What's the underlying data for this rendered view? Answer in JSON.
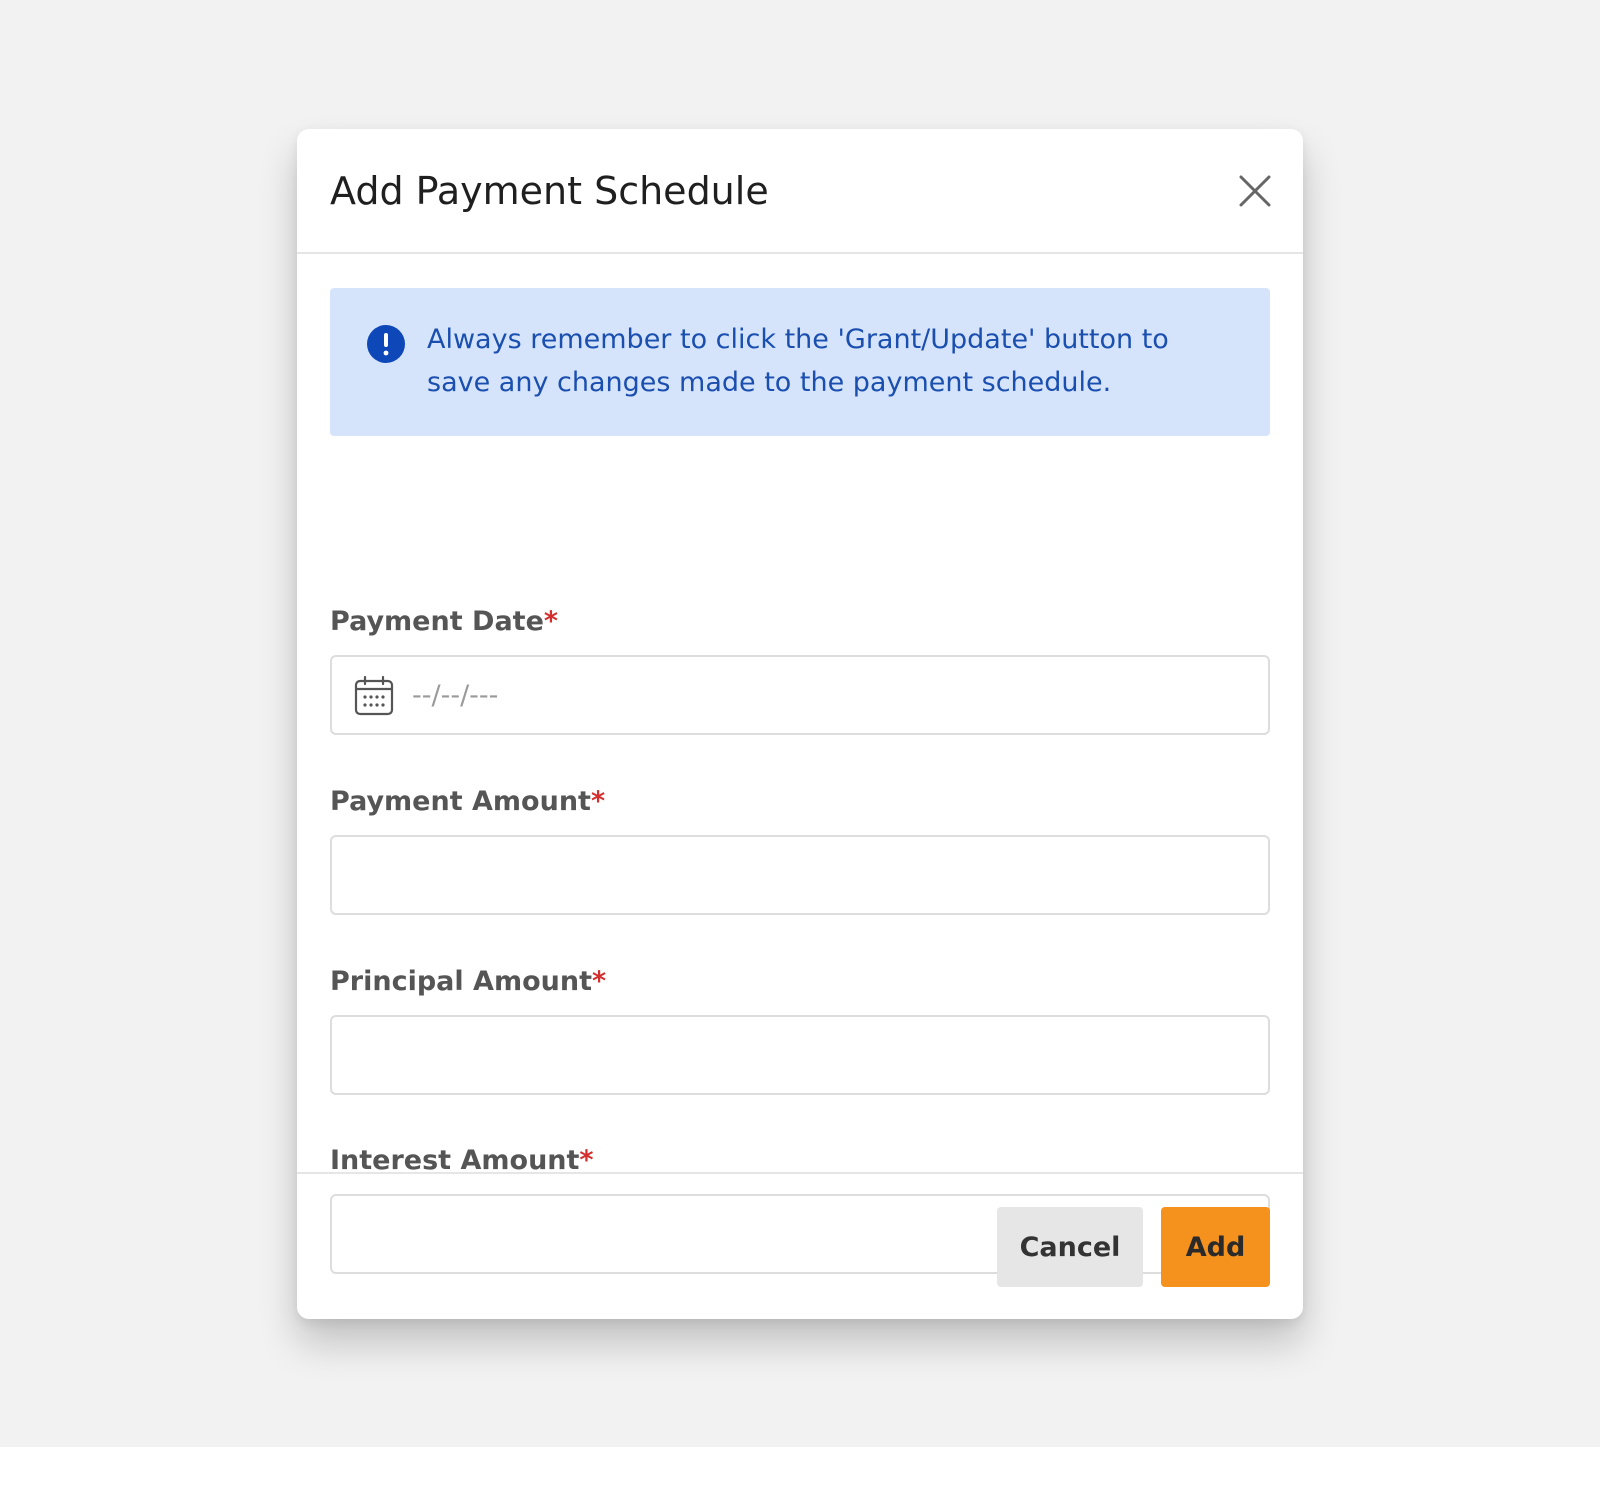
{
  "modal": {
    "title": "Add Payment Schedule",
    "close_icon": "close-icon"
  },
  "alert": {
    "icon": "info-exclamation-icon",
    "message": "Always remember to click the 'Grant/Update' button to save any changes made to the payment schedule.",
    "background": "#d6e4fb",
    "text_color": "#1a4fb0"
  },
  "fields": {
    "payment_date": {
      "label": "Payment Date",
      "required_marker": "*",
      "placeholder": "--/--/---",
      "value": "",
      "icon": "calendar-icon"
    },
    "payment_amount": {
      "label": "Payment Amount",
      "required_marker": "*",
      "value": ""
    },
    "principal_amount": {
      "label": "Principal Amount",
      "required_marker": "*",
      "value": ""
    },
    "interest_amount": {
      "label": "Interest Amount",
      "required_marker": "*",
      "value": ""
    }
  },
  "footer": {
    "cancel_label": "Cancel",
    "add_label": "Add",
    "add_color": "#f5921d"
  }
}
